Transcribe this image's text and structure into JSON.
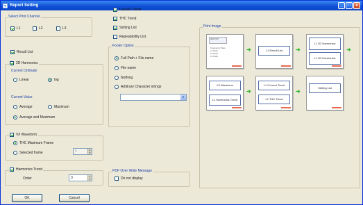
{
  "window": {
    "title": "Report Setting",
    "min": "_",
    "max": "□",
    "close": "x"
  },
  "colors": {
    "title_bar": "#1050d8",
    "group_label": "#1a3ea8",
    "check": "#21a121",
    "arrow": "#2bb52b",
    "face": "#ece9d8"
  },
  "print_channel": {
    "label": "Select Print Channel",
    "items": [
      {
        "label": "L1",
        "checked": true
      },
      {
        "label": "L2",
        "checked": false
      },
      {
        "label": "L3",
        "checked": false
      }
    ]
  },
  "result_list": {
    "label": "Result List",
    "checked": true
  },
  "harmonics_2d": {
    "label": "2D Harmonics",
    "checked": true,
    "ordinate": {
      "label": "Current Ordinate",
      "linear": "Linear",
      "log": "log",
      "selected": "log"
    },
    "value": {
      "label": "Current Value",
      "average": "Average",
      "maximum": "Maximum",
      "both": "Average and Maximum",
      "selected": "both"
    }
  },
  "vi_waveform": {
    "label": "V/I Waveform",
    "checked": true,
    "thc_max": "THC Maximum Frame",
    "selected_frame": "Selected frame",
    "frame_value": "0"
  },
  "harmonics_trend": {
    "label": "Harmonics Trend",
    "checked": true,
    "order_label": "Order",
    "order_value": "3"
  },
  "buttons": {
    "ok": "OK",
    "cancel": "Cancel"
  },
  "trend_options": [
    {
      "label": "Current Trend",
      "checked": true
    },
    {
      "label": "THC Trend",
      "checked": true
    },
    {
      "label": "Setting List",
      "checked": true
    },
    {
      "label": "Repeatability List",
      "checked": false
    }
  ],
  "footer_option": {
    "label": "Footer Option",
    "items": [
      "Full Path + File name",
      "File name",
      "Nothing",
      "Arbitrary Character strings"
    ],
    "selected": 0,
    "combo_value": ""
  },
  "pdf_message": {
    "label": "PDF Over Write Message",
    "option": "Do not display",
    "checked": false
  },
  "print_image": {
    "label": "Print Image",
    "report": {
      "title": "REPORT",
      "lines": [
        "Frequency  Pass",
        "L1    Pass",
        "L2    Pass",
        "L3    Pass"
      ]
    },
    "boxes": {
      "result_list": "L1 Result List",
      "l1_2d_a": "L1 2D Harmonics",
      "l1_2d_b": "L1 2D Harmonics",
      "vi_waveform": "V/I Waveform",
      "harmonics_trend": "L1 Harmonics Trend",
      "current_trend": "L1 Current Trend",
      "thc_trend": "L1 THC Trend",
      "setting_list": "Setting List"
    }
  }
}
